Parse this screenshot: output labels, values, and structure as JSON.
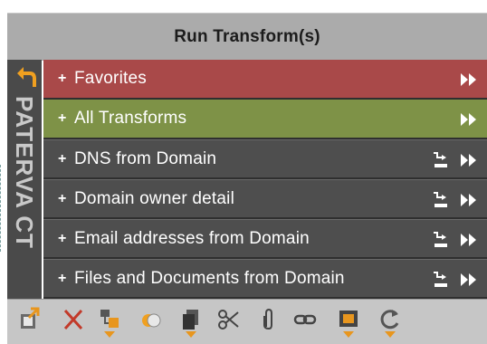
{
  "header": {
    "title": "Run Transform(s)"
  },
  "sidebar": {
    "vertical_label": "PATERVA CT",
    "back_icon": "back-arrow-icon"
  },
  "rows": [
    {
      "prefix": "+",
      "label": "Favorites",
      "style": "favorites",
      "has_settings": false
    },
    {
      "prefix": "+",
      "label": "All Transforms",
      "style": "all",
      "has_settings": false
    },
    {
      "prefix": "+",
      "label": "DNS from Domain",
      "style": "dark",
      "has_settings": true
    },
    {
      "prefix": "+",
      "label": "Domain owner detail",
      "style": "dark",
      "has_settings": true
    },
    {
      "prefix": "+",
      "label": "Email addresses from Domain",
      "style": "dark",
      "has_settings": true
    },
    {
      "prefix": "+",
      "label": "Files and Documents from Domain",
      "style": "dark",
      "has_settings": true
    }
  ],
  "toolbar": {
    "icons": [
      "import-icon",
      "delete-icon",
      "change-type-icon",
      "merge-icon",
      "copy-icon",
      "cut-icon",
      "attach-icon",
      "link-icon",
      "select-icon",
      "refresh-icon"
    ]
  },
  "colors": {
    "favorites": "#a94949",
    "all": "#7e9247",
    "dark": "#4e4e4e",
    "header": "#ababab",
    "toolbar": "#c6c6c6",
    "accent": "#e8961e"
  }
}
